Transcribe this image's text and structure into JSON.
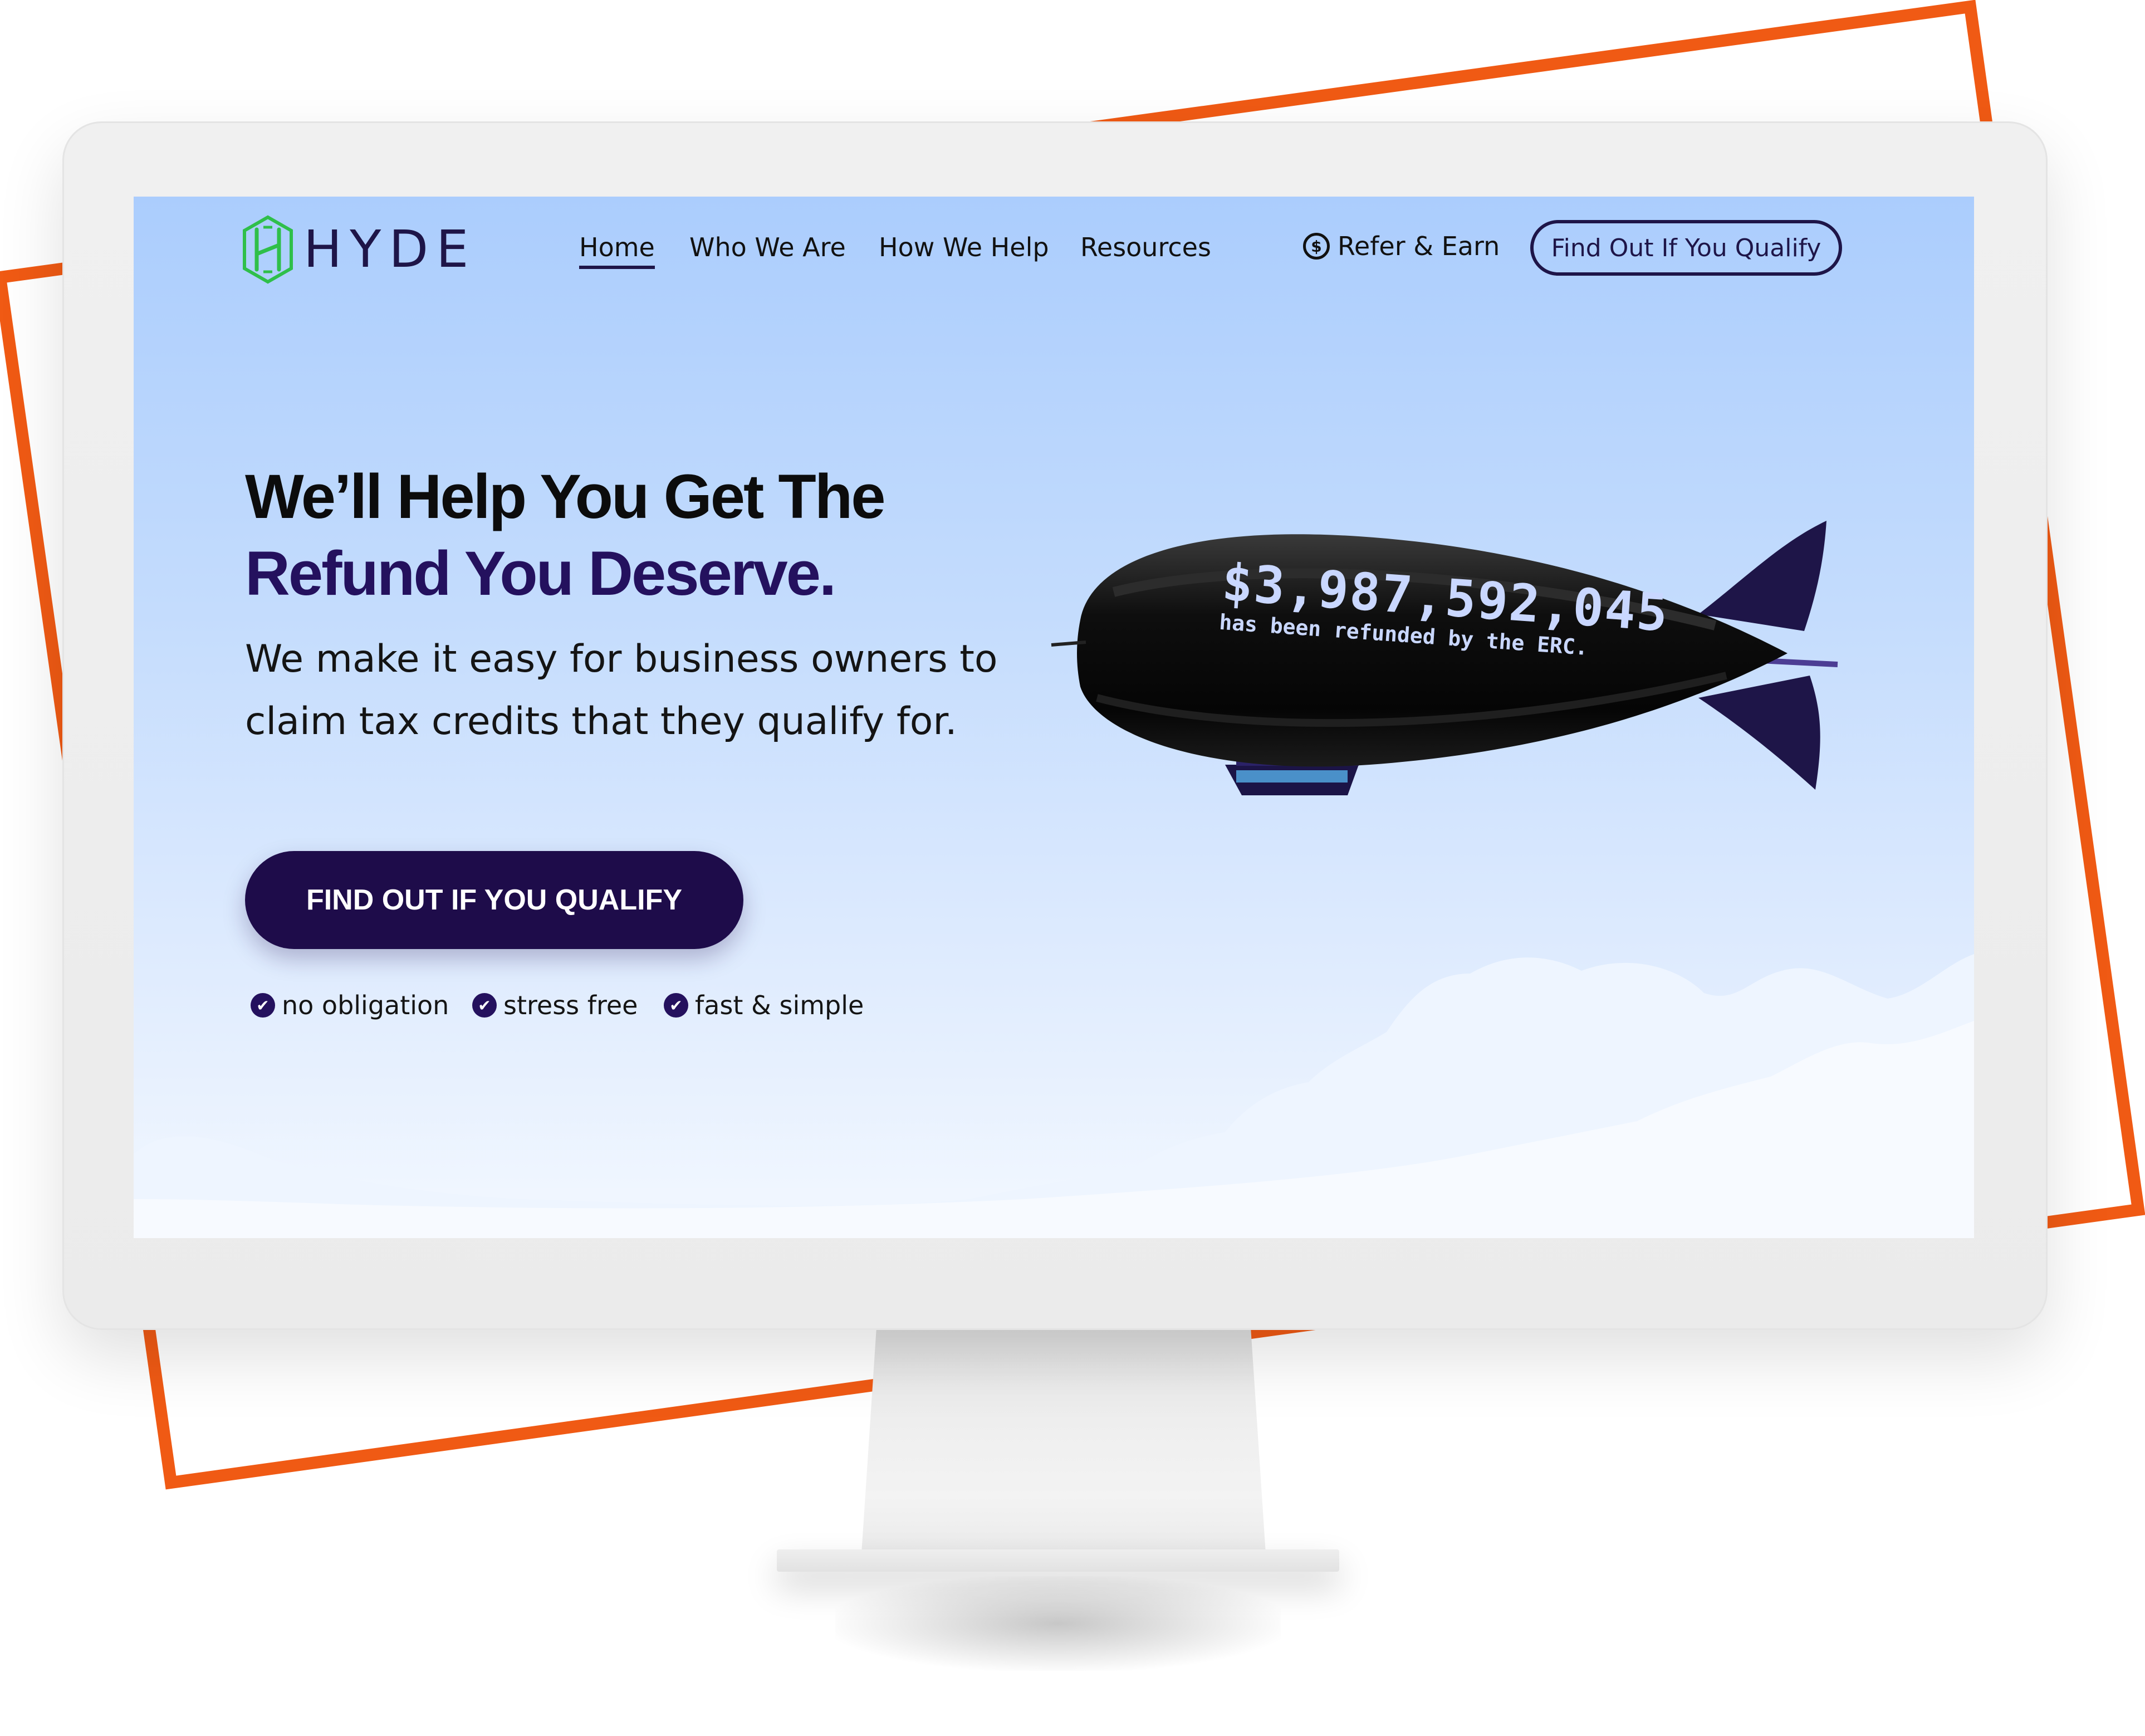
{
  "brand": {
    "name": "HYDE",
    "logo_icon": "hyde-h-mark-icon",
    "accent_color": "#24115e",
    "logo_color": "#2fbf4a",
    "frame_color": "#f05a14"
  },
  "nav": {
    "links": [
      {
        "label": "Home",
        "active": true
      },
      {
        "label": "Who We Are",
        "active": false
      },
      {
        "label": "How We Help",
        "active": false
      },
      {
        "label": "Resources",
        "active": false
      }
    ],
    "refer": {
      "label": "Refer & Earn",
      "icon": "dollar-circle-icon",
      "icon_glyph": "$"
    },
    "cta_label": "Find Out If You Qualify"
  },
  "hero": {
    "headline_line1": "We’ll Help You Get The",
    "headline_line2": "Refund You Deserve.",
    "subtext": "We make it easy for business owners to claim tax credits that they qualify for.",
    "cta_label": "FIND OUT IF YOU QUALIFY",
    "checks": [
      {
        "label": "no obligation",
        "icon": "check-circle-icon"
      },
      {
        "label": "stress free",
        "icon": "check-circle-icon"
      },
      {
        "label": "fast & simple",
        "icon": "check-circle-icon"
      }
    ]
  },
  "blimp": {
    "amount": "$3,987,592,045",
    "caption": "has been refunded by the ERC."
  }
}
